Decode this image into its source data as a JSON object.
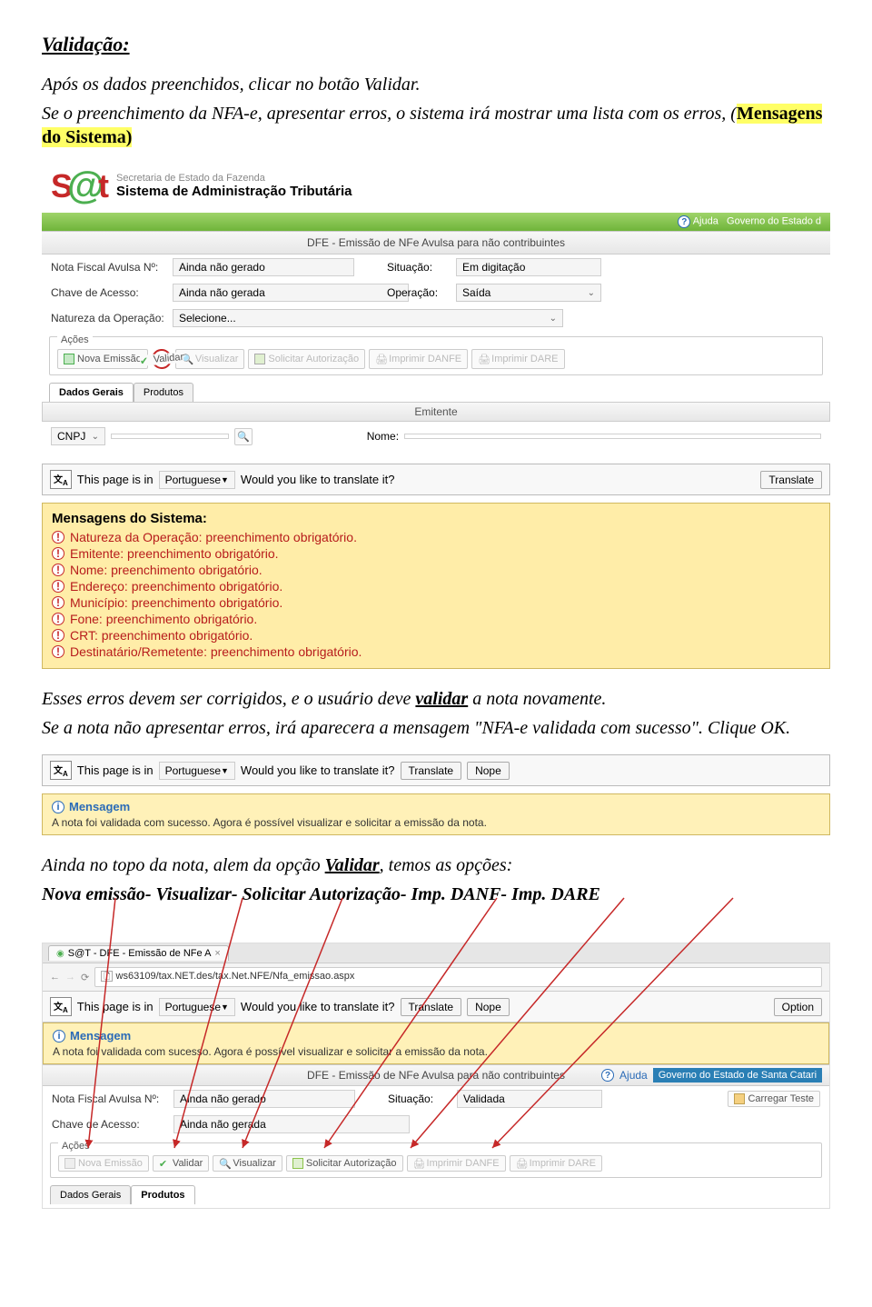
{
  "heading": "Validação:",
  "intro_p1": "Após os dados preenchidos, clicar no botão Validar.",
  "intro_p2a": "Se o preenchimento da NFA-e, apresentar erros, o sistema irá mostrar uma lista com os erros, (",
  "intro_p2_hl": "Mensagens do Sistema)",
  "sat": {
    "line1": "Secretaria de Estado da Fazenda",
    "line2": "Sistema de Administração Tributária"
  },
  "title_bar": "DFE - Emissão de NFe Avulsa para não contribuintes",
  "help": "Ajuda",
  "gov": "Governo do Estado d",
  "form": {
    "nfa_no_label": "Nota Fiscal Avulsa Nº:",
    "nfa_no_value": "Ainda não gerado",
    "situacao_label": "Situação:",
    "situacao_value": "Em digitação",
    "chave_label": "Chave de Acesso:",
    "chave_value": "Ainda não gerada",
    "operacao_label": "Operação:",
    "operacao_value": "Saída",
    "nat_label": "Natureza da Operação:",
    "nat_value": "Selecione..."
  },
  "actions_label": "Ações",
  "actions": {
    "nova": "Nova Emissão",
    "validar": "Validar",
    "visualizar": "Visualizar",
    "solicitar": "Solicitar Autorização",
    "danfe": "Imprimir DANFE",
    "dare": "Imprimir DARE"
  },
  "tabs": {
    "dados": "Dados Gerais",
    "produtos": "Produtos"
  },
  "emitente_header": "Emitente",
  "cnpj_label": "CNPJ",
  "nome_label": "Nome:",
  "translate_bar": {
    "prefix": "This page is in",
    "lang": "Portuguese",
    "question": "Would you like to translate it?",
    "btn": "Translate",
    "nope": "Nope",
    "option": "Option"
  },
  "sys_msgs_header": "Mensagens do Sistema:",
  "sys_msgs": [
    "Natureza da Operação: preenchimento obrigatório.",
    "Emitente: preenchimento obrigatório.",
    "Nome: preenchimento obrigatório.",
    "Endereço: preenchimento obrigatório.",
    "Município: preenchimento obrigatório.",
    "Fone: preenchimento obrigatório.",
    "CRT: preenchimento obrigatório.",
    "Destinatário/Remetente: preenchimento obrigatório."
  ],
  "mid_p1": "Esses erros devem ser corrigidos, e o usuário deve ",
  "mid_p1_bold": "validar",
  "mid_p1_end": " a nota novamente.",
  "mid_p2": "Se a nota não apresentar erros, irá aparecera a mensagem \"NFA-e validada com sucesso\". Clique OK.",
  "msg2_header": "Mensagem",
  "msg2_text": "A nota foi validada com sucesso. Agora é possível visualizar e solicitar a emissão da nota.",
  "bottom_p1": "Ainda no topo da nota, alem da opção ",
  "bottom_p1_bold": "Validar",
  "bottom_p1_end": ", temos as opções:",
  "bottom_p2": "Nova emissão- Visualizar- Solicitar Autorização- Imp. DANF- Imp. DARE",
  "browser": {
    "tab_title": "S@T - DFE - Emissão de NFe A",
    "url": "ws63109/tax.NET.des/tax.Net.NFE/Nfa_emissao.aspx"
  },
  "form2": {
    "situacao_value": "Validada",
    "carregar": "Carregar Teste"
  },
  "gov_full": "Governo do Estado de Santa Catari"
}
